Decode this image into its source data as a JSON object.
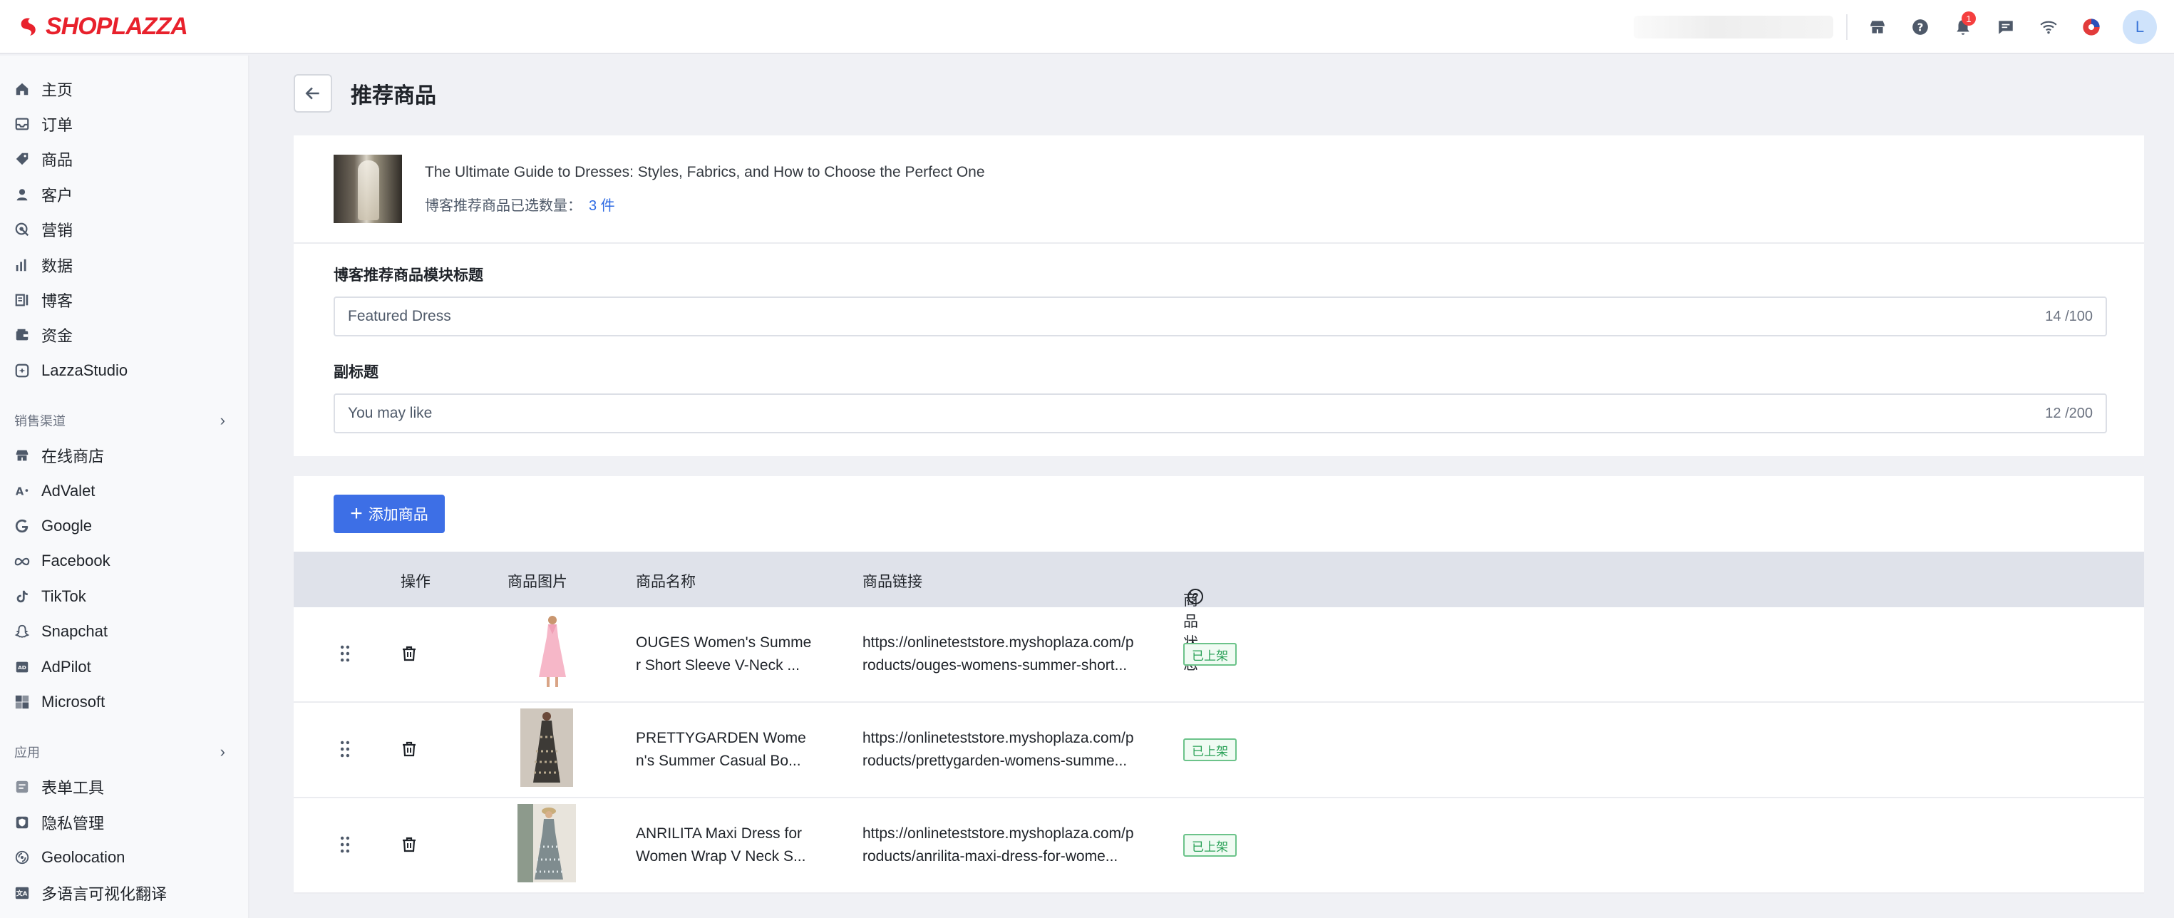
{
  "brand": {
    "name": "SHOPLAZZA",
    "color": "#e8212c"
  },
  "topbar": {
    "icons": [
      "store-icon",
      "help-icon",
      "bell-icon",
      "message-icon",
      "wifi-icon",
      "sync-icon"
    ],
    "notification_count": "1",
    "avatar_letter": "L"
  },
  "sidebar": {
    "items": [
      {
        "label": "主页",
        "icon": "home-icon"
      },
      {
        "label": "订单",
        "icon": "inbox-icon"
      },
      {
        "label": "商品",
        "icon": "tag-icon"
      },
      {
        "label": "客户",
        "icon": "user-icon"
      },
      {
        "label": "营销",
        "icon": "marketing-icon"
      },
      {
        "label": "数据",
        "icon": "bar-chart-icon"
      },
      {
        "label": "博客",
        "icon": "blog-icon"
      },
      {
        "label": "资金",
        "icon": "wallet-icon"
      },
      {
        "label": "LazzaStudio",
        "icon": "studio-icon"
      }
    ],
    "sales_section": "销售渠道",
    "channels": [
      {
        "label": "在线商店",
        "icon": "store-icon"
      },
      {
        "label": "AdValet",
        "icon": "advalet-icon"
      },
      {
        "label": "Google",
        "icon": "google-icon"
      },
      {
        "label": "Facebook",
        "icon": "meta-icon"
      },
      {
        "label": "TikTok",
        "icon": "tiktok-icon"
      },
      {
        "label": "Snapchat",
        "icon": "snapchat-icon"
      },
      {
        "label": "AdPilot",
        "icon": "adpilot-icon"
      },
      {
        "label": "Microsoft",
        "icon": "microsoft-icon"
      }
    ],
    "apps_section": "应用",
    "apps": [
      {
        "label": "表单工具",
        "icon": "form-icon"
      },
      {
        "label": "隐私管理",
        "icon": "privacy-icon"
      },
      {
        "label": "Geolocation",
        "icon": "geolocation-icon"
      },
      {
        "label": "多语言可视化翻译",
        "icon": "translate-icon"
      }
    ]
  },
  "page": {
    "title": "推荐商品",
    "blog_title": "The Ultimate Guide to Dresses: Styles, Fabrics, and How to Choose the Perfect One",
    "selected_label": "博客推荐商品已选数量：",
    "selected_count": "3 件",
    "module_title_label": "博客推荐商品模块标题",
    "module_title_value": "Featured Dress",
    "module_title_counter": "14 /100",
    "subtitle_label": "副标题",
    "subtitle_value": "You may like",
    "subtitle_counter": "12 /200",
    "add_button": "添加商品"
  },
  "table": {
    "headers": {
      "action": "操作",
      "image": "商品图片",
      "name": "商品名称",
      "link": "商品链接",
      "status": "商品状态"
    },
    "rows": [
      {
        "name_line1": "OUGES Women's Summe",
        "name_line2": "r Short Sleeve V-Neck ...",
        "link_line1": "https://onlineteststore.myshoplaza.com/p",
        "link_line2": "roducts/ouges-womens-summer-short...",
        "status": "已上架"
      },
      {
        "name_line1": "PRETTYGARDEN Wome",
        "name_line2": "n's Summer Casual Bo...",
        "link_line1": "https://onlineteststore.myshoplaza.com/p",
        "link_line2": "roducts/prettygarden-womens-summe...",
        "status": "已上架"
      },
      {
        "name_line1": "ANRILITA Maxi Dress for",
        "name_line2": "Women Wrap V Neck S...",
        "link_line1": "https://onlineteststore.myshoplaza.com/p",
        "link_line2": "roducts/anrilita-maxi-dress-for-wome...",
        "status": "已上架"
      }
    ]
  },
  "colors": {
    "primary": "#3d6fe6",
    "link": "#2d6ae3",
    "status_green": "#2aa157"
  }
}
